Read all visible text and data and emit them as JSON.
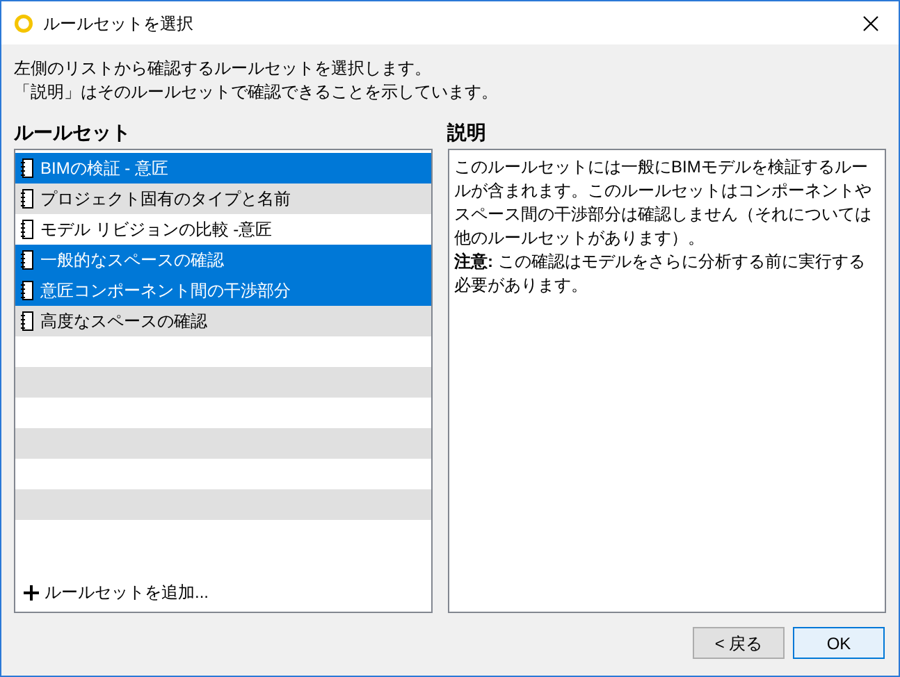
{
  "window": {
    "title": "ルールセットを選択"
  },
  "instructions": [
    "左側のリストから確認するルールセットを選択します。",
    "「説明」はそのルールセットで確認できることを示しています。"
  ],
  "ruleset_panel": {
    "heading": "ルールセット",
    "items": [
      {
        "label": "BIMの検証 - 意匠",
        "selected": true
      },
      {
        "label": "プロジェクト固有のタイプと名前",
        "selected": false
      },
      {
        "label": "モデル リビジョンの比較 -意匠",
        "selected": false
      },
      {
        "label": "一般的なスペースの確認",
        "selected": true
      },
      {
        "label": "意匠コンポーネント間の干渉部分",
        "selected": true
      },
      {
        "label": "高度なスペースの確認",
        "selected": false
      }
    ],
    "add_link": "ルールセットを追加..."
  },
  "description_panel": {
    "heading": "説明",
    "paragraphs": [
      "このルールセットには一般にBIMモデルを検証するルールが含まれます。このルールセットはコンポーネントやスペース間の干渉部分は確認しません（それについては他のルールセットがあります）。",
      "**注意:** この確認はモデルをさらに分析する前に実行する必要があります。"
    ]
  },
  "buttons": [
    {
      "label": "< 戻る",
      "kind": "secondary"
    },
    {
      "label": "OK",
      "kind": "default"
    }
  ]
}
